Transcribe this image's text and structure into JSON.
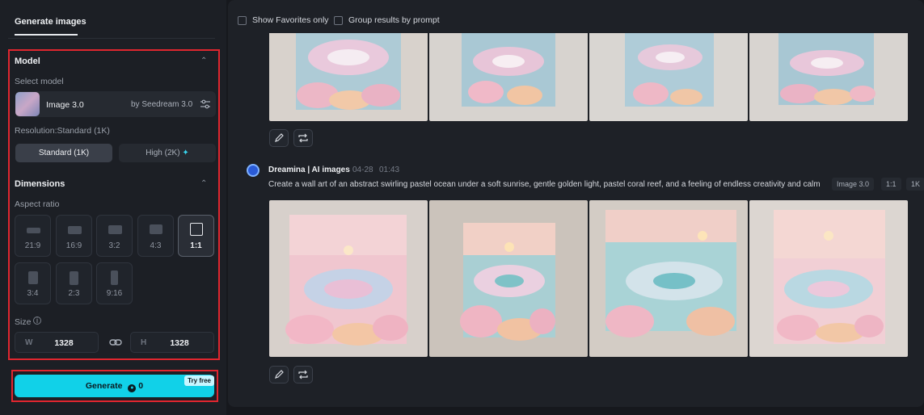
{
  "sidebar": {
    "tab_label": "Generate images",
    "model": {
      "section_title": "Model",
      "select_label": "Select model",
      "name": "Image 3.0",
      "provider": "by Seedream 3.0",
      "resolution_label": "Resolution:Standard (1K)",
      "resolution_options": [
        {
          "label": "Standard (1K)",
          "selected": true
        },
        {
          "label": "High (2K)",
          "selected": false
        }
      ]
    },
    "dimensions": {
      "section_title": "Dimensions",
      "aspect_label": "Aspect ratio",
      "aspect_ratios": [
        {
          "label": "21:9",
          "selected": false
        },
        {
          "label": "16:9",
          "selected": false
        },
        {
          "label": "3:2",
          "selected": false
        },
        {
          "label": "4:3",
          "selected": false
        },
        {
          "label": "1:1",
          "selected": true
        },
        {
          "label": "3:4",
          "selected": false
        },
        {
          "label": "2:3",
          "selected": false
        },
        {
          "label": "9:16",
          "selected": false
        }
      ],
      "size_label": "Size",
      "width_prefix": "W",
      "width": "1328",
      "height_prefix": "H",
      "height": "1328"
    },
    "generate": {
      "label": "Generate",
      "credits": "0",
      "badge": "Try free",
      "accent": "#11d1e8"
    }
  },
  "main": {
    "filters": {
      "favorites_label": "Show Favorites only",
      "group_label": "Group results by prompt"
    },
    "entry": {
      "author": "Dreamina | AI images",
      "date": "04-28",
      "time": "01:43",
      "prompt": "Create a wall art of an abstract swirling pastel ocean under a soft sunrise, gentle golden light, pastel coral reef, and a feeling of endless creativity and calm",
      "tags": [
        "Image 3.0",
        "1:1",
        "1K"
      ]
    }
  }
}
